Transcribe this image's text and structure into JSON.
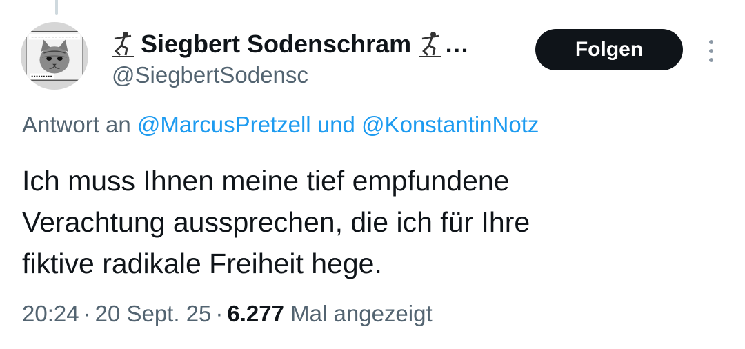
{
  "author": {
    "display_name": "Siegbert Sodenschram",
    "ellipsis": "…",
    "handle": "@SiegbertSodensc",
    "avatar_text_top": "YOU DON'T HAVE TO BE LIKEABLE",
    "avatar_text_bottom": "BE AUTHENTIC",
    "emoji_icon": "kneeling-figure-icon"
  },
  "actions": {
    "follow_label": "Folgen",
    "more_icon": "more-vertical-icon"
  },
  "reply": {
    "prefix": "Antwort an ",
    "mention_1": "@MarcusPretzell",
    "connector": " und ",
    "mention_2": "@KonstantinNotz"
  },
  "tweet": {
    "lines": [
      "Ich muss Ihnen meine tief empfundene",
      "Verachtung aussprechen, die ich für Ihre",
      "fiktive radikale Freiheit hege."
    ]
  },
  "meta": {
    "time": "20:24",
    "separator": "·",
    "date": "20 Sept. 25",
    "views_count": "6.277",
    "views_label": "Mal angezeigt"
  },
  "colors": {
    "link": "#1d9bf0",
    "secondary_text": "#536471",
    "primary_text": "#0f1419",
    "button_bg": "#0f1419"
  }
}
